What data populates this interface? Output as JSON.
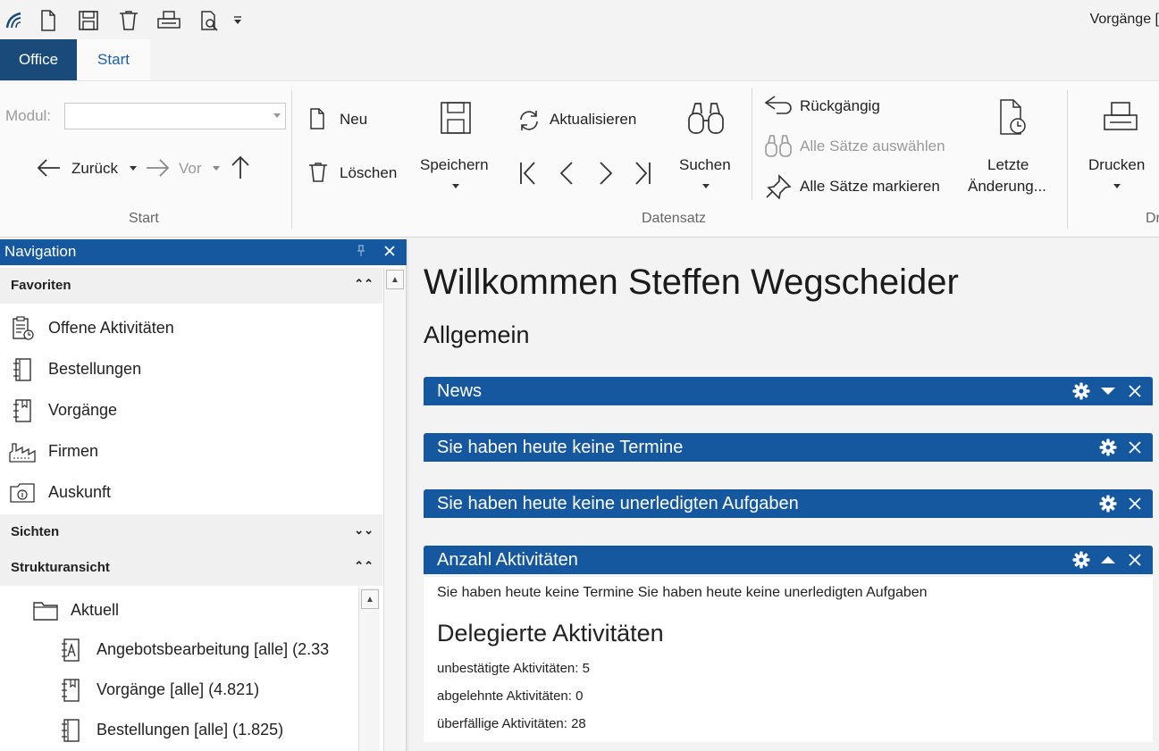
{
  "window": {
    "title": "Vorgänge ["
  },
  "quick_access": {
    "icons": [
      "app-logo-icon",
      "new-document-icon",
      "save-icon",
      "delete-icon",
      "print-icon",
      "print-preview-icon",
      "customize-dropdown-icon"
    ]
  },
  "tabs": {
    "office": "Office",
    "start": "Start"
  },
  "ribbon": {
    "group_start": {
      "label": "Start",
      "modul_label": "Modul:",
      "modul_value": "",
      "back_label": "Zurück",
      "forward_label": "Vor"
    },
    "group_datensatz": {
      "label": "Datensatz",
      "new_label": "Neu",
      "delete_label": "Löschen",
      "save_label": "Speichern",
      "refresh_label": "Aktualisieren",
      "search_label": "Suchen",
      "undo_label": "Rückgängig",
      "select_all_label": "Alle Sätze auswählen",
      "mark_all_label": "Alle Sätze markieren",
      "last_changes_line1": "Letzte",
      "last_changes_line2": "Änderung..."
    },
    "group_print": {
      "label": "Dr",
      "print_label": "Drucken"
    }
  },
  "nav": {
    "title": "Navigation",
    "favoriten": {
      "label": "Favoriten",
      "items": [
        {
          "label": "Offene Aktivitäten",
          "icon": "activities-icon"
        },
        {
          "label": "Bestellungen",
          "icon": "orders-icon"
        },
        {
          "label": "Vorgänge",
          "icon": "processes-icon"
        },
        {
          "label": "Firmen",
          "icon": "companies-icon"
        },
        {
          "label": "Auskunft",
          "icon": "info-icon"
        }
      ]
    },
    "sichten": {
      "label": "Sichten"
    },
    "struktur": {
      "label": "Strukturansicht",
      "folder": "Aktuell",
      "items": [
        {
          "label": "Angebotsbearbeitung [alle] (2.33",
          "icon": "quote-icon"
        },
        {
          "label": "Vorgänge [alle] (4.821)",
          "icon": "processes-icon"
        },
        {
          "label": "Bestellungen [alle] (1.825)",
          "icon": "orders-icon"
        }
      ]
    }
  },
  "main": {
    "welcome": "Willkommen Steffen Wegscheider",
    "section": "Allgemein",
    "widgets": [
      {
        "title": "News"
      },
      {
        "title": "Sie haben heute keine Termine"
      },
      {
        "title": "Sie haben heute keine unerledigten Aufgaben"
      },
      {
        "title": "Anzahl Aktivitäten"
      }
    ],
    "body": {
      "summary": "Sie haben heute keine Termine Sie haben heute keine unerledigten Aufgaben",
      "heading": "Delegierte Aktivitäten",
      "lines": [
        "unbestätigte Aktivitäten: 5",
        "abgelehnte Aktivitäten: 0",
        "überfällige Aktivitäten: 28"
      ]
    }
  },
  "colors": {
    "accent": "#1558a0",
    "office_tab": "#1a4a7a",
    "start_tab_text": "#1a5fa8"
  }
}
